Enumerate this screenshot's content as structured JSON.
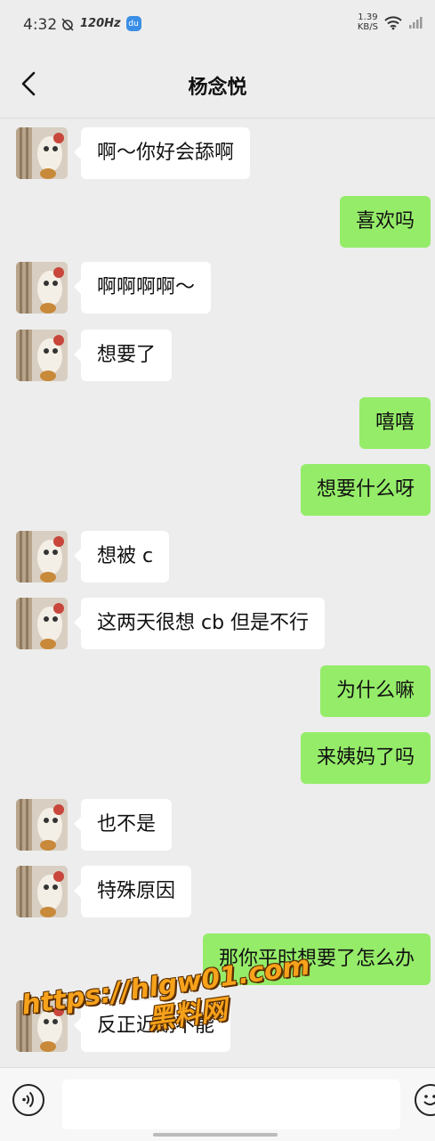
{
  "status_bar": {
    "time": "4:32",
    "refresh_rate": "120Hz",
    "app_badge": "du",
    "net_speed_value": "1.39",
    "net_speed_unit": "KB/S"
  },
  "header": {
    "title": "杨念悦"
  },
  "colors": {
    "sent_bubble": "#95ec69",
    "received_bubble": "#ffffff",
    "background": "#ededed"
  },
  "messages": [
    {
      "side": "left",
      "text": "啊～你好会舔啊"
    },
    {
      "side": "right",
      "text": "喜欢吗"
    },
    {
      "side": "left",
      "text": "啊啊啊啊～"
    },
    {
      "side": "left",
      "text": "想要了"
    },
    {
      "side": "right",
      "text": "嘻嘻"
    },
    {
      "side": "right",
      "text": "想要什么呀"
    },
    {
      "side": "left",
      "text": "想被 c"
    },
    {
      "side": "left",
      "text": "这两天很想 cb 但是不行"
    },
    {
      "side": "right",
      "text": "为什么嘛"
    },
    {
      "side": "right",
      "text": "来姨妈了吗"
    },
    {
      "side": "left",
      "text": "也不是"
    },
    {
      "side": "left",
      "text": "特殊原因"
    },
    {
      "side": "right",
      "text": "那你平时想要了怎么办"
    },
    {
      "side": "left",
      "text": "反正近期不能"
    }
  ],
  "watermark": {
    "url": "https://hlgw01.com",
    "name": "黑料网"
  }
}
